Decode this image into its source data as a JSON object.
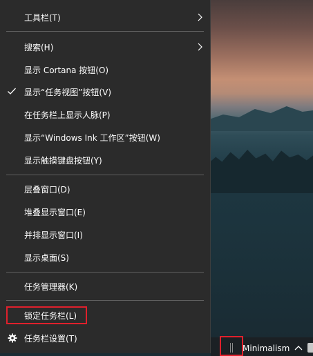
{
  "menu": {
    "items": [
      {
        "label": "工具栏(T)",
        "has_submenu": true
      },
      {
        "label": "搜索(H)",
        "has_submenu": true
      },
      {
        "label": "显示 Cortana 按钮(O)"
      },
      {
        "label": "显示“任务视图”按钮(V)",
        "checked": true
      },
      {
        "label": "在任务栏上显示人脉(P)"
      },
      {
        "label": "显示“Windows Ink 工作区”按钮(W)"
      },
      {
        "label": "显示触摸键盘按钮(Y)"
      },
      {
        "label": "层叠窗口(D)"
      },
      {
        "label": "堆叠显示窗口(E)"
      },
      {
        "label": "并排显示窗口(I)"
      },
      {
        "label": "显示桌面(S)"
      },
      {
        "label": "任务管理器(K)"
      },
      {
        "label": "锁定任务栏(L)",
        "highlighted": true
      },
      {
        "label": "任务栏设置(T)",
        "icon": "gear-icon"
      }
    ]
  },
  "taskbar": {
    "toolbar_label": "Minimalism",
    "icons": [
      "taskbar-grip-icon",
      "chevron-up-icon"
    ]
  },
  "colors": {
    "menu_bg": "#2b2b2b",
    "highlight_border": "#e0202c",
    "text": "#ffffff"
  }
}
